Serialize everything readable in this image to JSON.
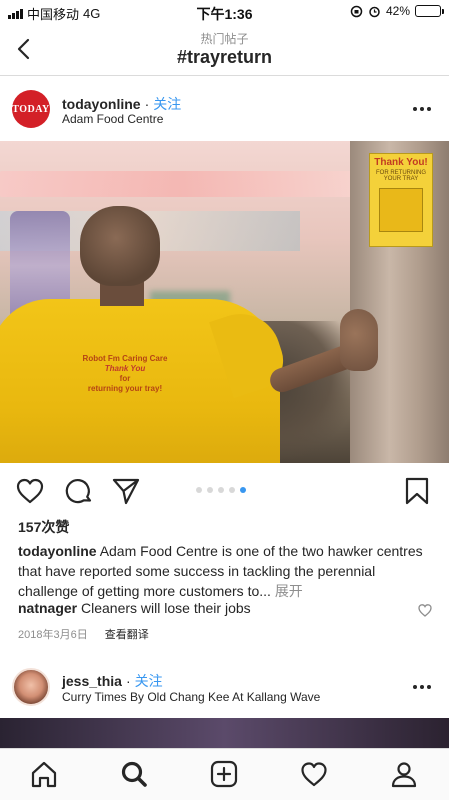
{
  "status_bar": {
    "carrier": "中国移动",
    "network": "4G",
    "time": "下午1:36",
    "battery": "42%",
    "battery_level": 0.42
  },
  "nav": {
    "subtitle": "热门帖子",
    "title": "#trayreturn"
  },
  "post": {
    "avatar_text": "TODAY",
    "username": "todayonline",
    "separator": "·",
    "follow_label": "关注",
    "location": "Adam Food Centre",
    "photo": {
      "sign_title": "Thank You!",
      "sign_sub": "FOR RETURNING YOUR TRAY",
      "shirt_line1": "Robot Fm Caring Care",
      "shirt_line2": "Thank You",
      "shirt_line3": "for",
      "shirt_line4": "returning your tray!"
    },
    "carousel_count": 5,
    "carousel_active": 5,
    "likes": "157次赞",
    "caption_user": "todayonline",
    "caption_text": "Adam Food Centre is one of the two hawker centres that have reported some success in tackling the perennial challenge of getting more customers to...",
    "caption_more": "展开",
    "comment_user": "natnager",
    "comment_text": "Cleaners will lose their jobs",
    "date": "2018年3月6日",
    "translate_label": "查看翻译"
  },
  "next_post": {
    "username": "jess_thia",
    "separator": "·",
    "follow_label": "关注",
    "location": "Curry Times By Old Chang Kee At Kallang Wave"
  },
  "colors": {
    "accent": "#3897f0",
    "text": "#262626",
    "muted": "#8e8e8e",
    "brand_today": "#d32027"
  },
  "tabs": [
    "home-icon",
    "search-icon",
    "add-icon",
    "heart-icon",
    "profile-icon"
  ]
}
